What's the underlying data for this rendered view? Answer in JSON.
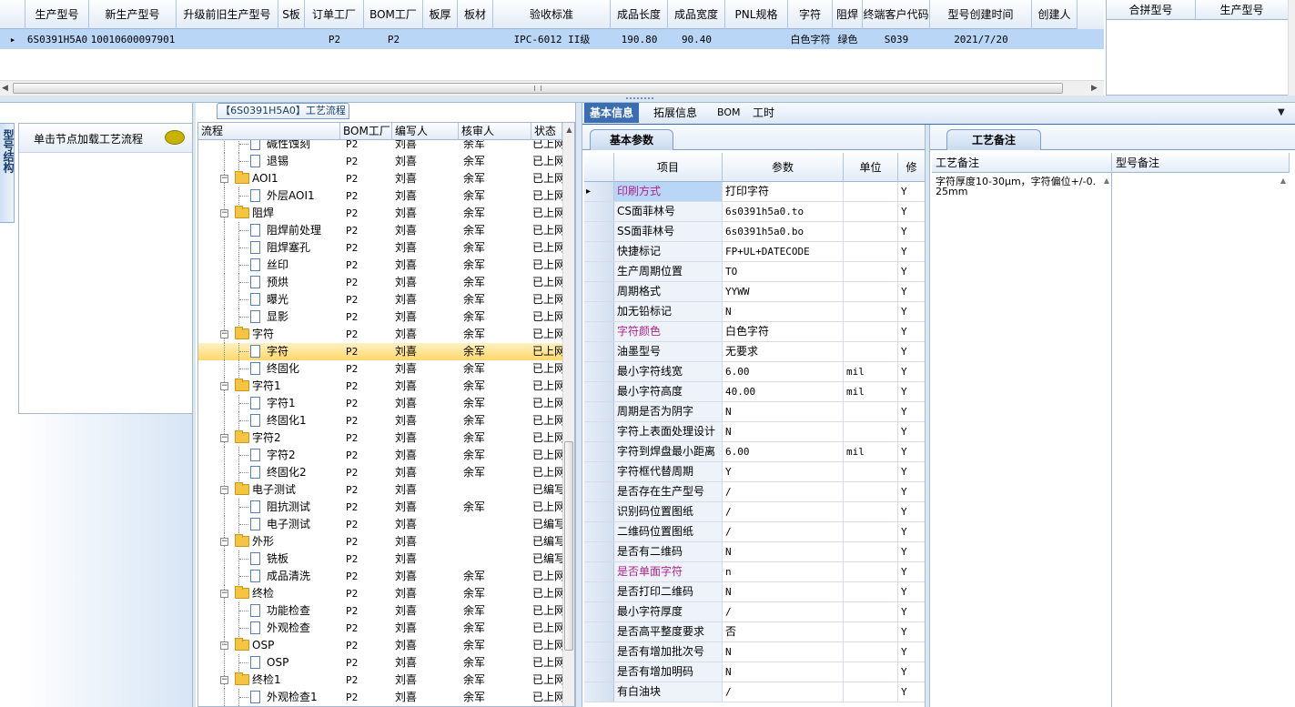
{
  "top_grid": {
    "columns": [
      "生产型号",
      "新生产型号",
      "升级前旧生产型号",
      "S板",
      "订单工厂",
      "BOM工厂",
      "板厚",
      "板材",
      "验收标准",
      "成品长度",
      "成品宽度",
      "PNL规格",
      "字符",
      "阻焊",
      "终端客户代码",
      "型号创建时间",
      "创建人"
    ],
    "row": {
      "indicator": "▸",
      "c0": "6S0391H5A0",
      "c1": "10010600097901",
      "c2": "",
      "c3": "",
      "c4": "P2",
      "c5": "P2",
      "c6": "",
      "c7": "",
      "c8": "IPC-6012 II级",
      "c9": "190.80",
      "c10": "90.40",
      "c11": "",
      "c12": "白色字符",
      "c13": "绿色",
      "c14": "S039",
      "c15": "2021/7/20",
      "c16": ""
    },
    "right_columns": [
      "合拼型号",
      "生产型号"
    ]
  },
  "left_panel": {
    "vertical_tab": "型号结构",
    "hint": "单击节点加载工艺流程",
    "chat_icon": "speech-bubble-icon"
  },
  "process": {
    "title": "【6S0391H5A0】工艺流程",
    "columns": [
      "流程",
      "BOM工厂",
      "编写人",
      "核审人",
      "状态"
    ],
    "rows": [
      {
        "level": 1,
        "type": "doc",
        "name": "碱性蚀刻",
        "bom": "P2",
        "writer": "刘喜",
        "auditor": "余军",
        "status": "已上网"
      },
      {
        "level": 1,
        "type": "doc",
        "name": "退锡",
        "bom": "P2",
        "writer": "刘喜",
        "auditor": "余军",
        "status": "已上网"
      },
      {
        "level": 0,
        "type": "folder",
        "name": "AOI1",
        "bom": "P2",
        "writer": "刘喜",
        "auditor": "余军",
        "status": "已上网"
      },
      {
        "level": 1,
        "type": "doc",
        "name": "外层AOI1",
        "bom": "P2",
        "writer": "刘喜",
        "auditor": "余军",
        "status": "已上网"
      },
      {
        "level": 0,
        "type": "folder",
        "name": "阻焊",
        "bom": "P2",
        "writer": "刘喜",
        "auditor": "余军",
        "status": "已上网"
      },
      {
        "level": 1,
        "type": "doc",
        "name": "阻焊前处理",
        "bom": "P2",
        "writer": "刘喜",
        "auditor": "余军",
        "status": "已上网"
      },
      {
        "level": 1,
        "type": "doc",
        "name": "阻焊塞孔",
        "bom": "P2",
        "writer": "刘喜",
        "auditor": "余军",
        "status": "已上网"
      },
      {
        "level": 1,
        "type": "doc",
        "name": "丝印",
        "bom": "P2",
        "writer": "刘喜",
        "auditor": "余军",
        "status": "已上网"
      },
      {
        "level": 1,
        "type": "doc",
        "name": "预烘",
        "bom": "P2",
        "writer": "刘喜",
        "auditor": "余军",
        "status": "已上网"
      },
      {
        "level": 1,
        "type": "doc",
        "name": "曝光",
        "bom": "P2",
        "writer": "刘喜",
        "auditor": "余军",
        "status": "已上网"
      },
      {
        "level": 1,
        "type": "doc",
        "name": "显影",
        "bom": "P2",
        "writer": "刘喜",
        "auditor": "余军",
        "status": "已上网"
      },
      {
        "level": 0,
        "type": "folder",
        "name": "字符",
        "bom": "P2",
        "writer": "刘喜",
        "auditor": "余军",
        "status": "已上网"
      },
      {
        "level": 1,
        "type": "doc",
        "name": "字符",
        "bom": "P2",
        "writer": "刘喜",
        "auditor": "余军",
        "status": "已上网",
        "selected": true
      },
      {
        "level": 1,
        "type": "doc",
        "name": "终固化",
        "bom": "P2",
        "writer": "刘喜",
        "auditor": "余军",
        "status": "已上网"
      },
      {
        "level": 0,
        "type": "folder",
        "name": "字符1",
        "bom": "P2",
        "writer": "刘喜",
        "auditor": "余军",
        "status": "已上网"
      },
      {
        "level": 1,
        "type": "doc",
        "name": "字符1",
        "bom": "P2",
        "writer": "刘喜",
        "auditor": "余军",
        "status": "已上网"
      },
      {
        "level": 1,
        "type": "doc",
        "name": "终固化1",
        "bom": "P2",
        "writer": "刘喜",
        "auditor": "余军",
        "status": "已上网"
      },
      {
        "level": 0,
        "type": "folder",
        "name": "字符2",
        "bom": "P2",
        "writer": "刘喜",
        "auditor": "余军",
        "status": "已上网"
      },
      {
        "level": 1,
        "type": "doc",
        "name": "字符2",
        "bom": "P2",
        "writer": "刘喜",
        "auditor": "余军",
        "status": "已上网"
      },
      {
        "level": 1,
        "type": "doc",
        "name": "终固化2",
        "bom": "P2",
        "writer": "刘喜",
        "auditor": "余军",
        "status": "已上网"
      },
      {
        "level": 0,
        "type": "folder",
        "name": "电子测试",
        "bom": "P2",
        "writer": "刘喜",
        "auditor": "",
        "status": "已编写"
      },
      {
        "level": 1,
        "type": "doc",
        "name": "阻抗测试",
        "bom": "P2",
        "writer": "刘喜",
        "auditor": "余军",
        "status": "已上网"
      },
      {
        "level": 1,
        "type": "doc",
        "name": "电子测试",
        "bom": "P2",
        "writer": "刘喜",
        "auditor": "",
        "status": "已编写"
      },
      {
        "level": 0,
        "type": "folder",
        "name": "外形",
        "bom": "P2",
        "writer": "刘喜",
        "auditor": "",
        "status": "已编写"
      },
      {
        "level": 1,
        "type": "doc",
        "name": "铣板",
        "bom": "P2",
        "writer": "刘喜",
        "auditor": "",
        "status": "已编写"
      },
      {
        "level": 1,
        "type": "doc",
        "name": "成品清洗",
        "bom": "P2",
        "writer": "刘喜",
        "auditor": "余军",
        "status": "已上网"
      },
      {
        "level": 0,
        "type": "folder",
        "name": "终检",
        "bom": "P2",
        "writer": "刘喜",
        "auditor": "余军",
        "status": "已上网"
      },
      {
        "level": 1,
        "type": "doc",
        "name": "功能检查",
        "bom": "P2",
        "writer": "刘喜",
        "auditor": "余军",
        "status": "已上网"
      },
      {
        "level": 1,
        "type": "doc",
        "name": "外观检查",
        "bom": "P2",
        "writer": "刘喜",
        "auditor": "余军",
        "status": "已上网"
      },
      {
        "level": 0,
        "type": "folder",
        "name": "OSP",
        "bom": "P2",
        "writer": "刘喜",
        "auditor": "余军",
        "status": "已上网"
      },
      {
        "level": 1,
        "type": "doc",
        "name": "OSP",
        "bom": "P2",
        "writer": "刘喜",
        "auditor": "余军",
        "status": "已上网"
      },
      {
        "level": 0,
        "type": "folder",
        "name": "终检1",
        "bom": "P2",
        "writer": "刘喜",
        "auditor": "余军",
        "status": "已上网"
      },
      {
        "level": 1,
        "type": "doc",
        "name": "外观检查1",
        "bom": "P2",
        "writer": "刘喜",
        "auditor": "余军",
        "status": "已上网"
      }
    ]
  },
  "tabs": [
    "基本信息",
    "拓展信息",
    "BOM",
    "工时"
  ],
  "basic": {
    "subtab": "基本参数",
    "columns": [
      "项目",
      "参数",
      "单位",
      "修"
    ],
    "rows": [
      {
        "item": "印刷方式",
        "value": "打印字符",
        "unit": "",
        "flag": "Y",
        "highlight": true,
        "current": true
      },
      {
        "item": "CS面菲林号",
        "value": "6s0391h5a0.to",
        "unit": "",
        "flag": "Y"
      },
      {
        "item": "SS面菲林号",
        "value": "6s0391h5a0.bo",
        "unit": "",
        "flag": "Y"
      },
      {
        "item": "快捷标记",
        "value": "FP+UL+DATECODE",
        "unit": "",
        "flag": "Y"
      },
      {
        "item": "生产周期位置",
        "value": "TO",
        "unit": "",
        "flag": "Y"
      },
      {
        "item": "周期格式",
        "value": "YYWW",
        "unit": "",
        "flag": "Y"
      },
      {
        "item": "加无铅标记",
        "value": "N",
        "unit": "",
        "flag": "Y"
      },
      {
        "item": "字符颜色",
        "value": "白色字符",
        "unit": "",
        "flag": "Y",
        "highlight": true
      },
      {
        "item": "油墨型号",
        "value": "无要求",
        "unit": "",
        "flag": "Y"
      },
      {
        "item": "最小字符线宽",
        "value": "6.00",
        "unit": "mil",
        "flag": "Y"
      },
      {
        "item": "最小字符高度",
        "value": "40.00",
        "unit": "mil",
        "flag": "Y"
      },
      {
        "item": "周期是否为阴字",
        "value": "N",
        "unit": "",
        "flag": "Y"
      },
      {
        "item": "字符上表面处理设计",
        "value": "N",
        "unit": "",
        "flag": "Y"
      },
      {
        "item": "字符到焊盘最小距离",
        "value": "6.00",
        "unit": "mil",
        "flag": "Y"
      },
      {
        "item": "字符框代替周期",
        "value": "Y",
        "unit": "",
        "flag": "Y"
      },
      {
        "item": "是否存在生产型号",
        "value": "/",
        "unit": "",
        "flag": "Y"
      },
      {
        "item": "识别码位置图纸",
        "value": "/",
        "unit": "",
        "flag": "Y"
      },
      {
        "item": "二维码位置图纸",
        "value": "/",
        "unit": "",
        "flag": "Y"
      },
      {
        "item": "是否有二维码",
        "value": "N",
        "unit": "",
        "flag": "Y"
      },
      {
        "item": "是否单面字符",
        "value": "n",
        "unit": "",
        "flag": "Y",
        "highlight": true
      },
      {
        "item": "是否打印二维码",
        "value": "N",
        "unit": "",
        "flag": "Y"
      },
      {
        "item": "最小字符厚度",
        "value": "/",
        "unit": "",
        "flag": "Y"
      },
      {
        "item": "是否高平整度要求",
        "value": "否",
        "unit": "",
        "flag": "Y"
      },
      {
        "item": "是否有增加批次号",
        "value": "N",
        "unit": "",
        "flag": "Y"
      },
      {
        "item": "是否有增加明码",
        "value": "N",
        "unit": "",
        "flag": "Y"
      },
      {
        "item": "有白油块",
        "value": "/",
        "unit": "",
        "flag": "Y"
      }
    ]
  },
  "remarks": {
    "tab": "工艺备注",
    "columns": [
      "工艺备注",
      "型号备注"
    ],
    "process_note": "字符厚度10-30μm，字符偏位+/-0.25mm",
    "model_note": ""
  },
  "colors": {
    "accent": "#1a5fb4",
    "selected_row": "#b9d6f7",
    "highlight_text": "#b0228c",
    "tab_bar": "#3b6db3"
  }
}
